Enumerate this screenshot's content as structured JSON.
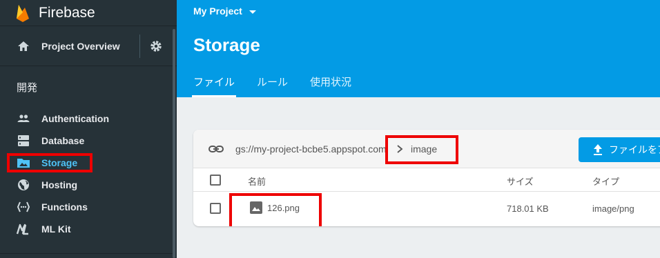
{
  "sidebar": {
    "brand": "Firebase",
    "overview_label": "Project Overview",
    "section_title": "開発",
    "items": [
      {
        "label": "Authentication",
        "icon": "people-icon"
      },
      {
        "label": "Database",
        "icon": "database-icon"
      },
      {
        "label": "Storage",
        "icon": "folder-image-icon",
        "active": true
      },
      {
        "label": "Hosting",
        "icon": "globe-icon"
      },
      {
        "label": "Functions",
        "icon": "functions-icon"
      },
      {
        "label": "ML Kit",
        "icon": "ml-kit-icon"
      }
    ]
  },
  "header": {
    "project": "My Project",
    "title": "Storage",
    "tabs": [
      {
        "label": "ファイル",
        "active": true
      },
      {
        "label": "ルール"
      },
      {
        "label": "使用状況"
      }
    ]
  },
  "storage": {
    "bucket_path": "gs://my-project-bcbe5.appspot.com",
    "folder": "image",
    "upload_label": "ファイルをア",
    "columns": {
      "name": "名前",
      "size": "サイズ",
      "type": "タイプ"
    },
    "files": [
      {
        "name": "126.png",
        "size": "718.01 KB",
        "type": "image/png"
      }
    ]
  },
  "colors": {
    "sidebar_bg": "#263238",
    "header_bg": "#039be5",
    "active_item": "#4fc3f7",
    "highlight_box": "#ee0000"
  }
}
